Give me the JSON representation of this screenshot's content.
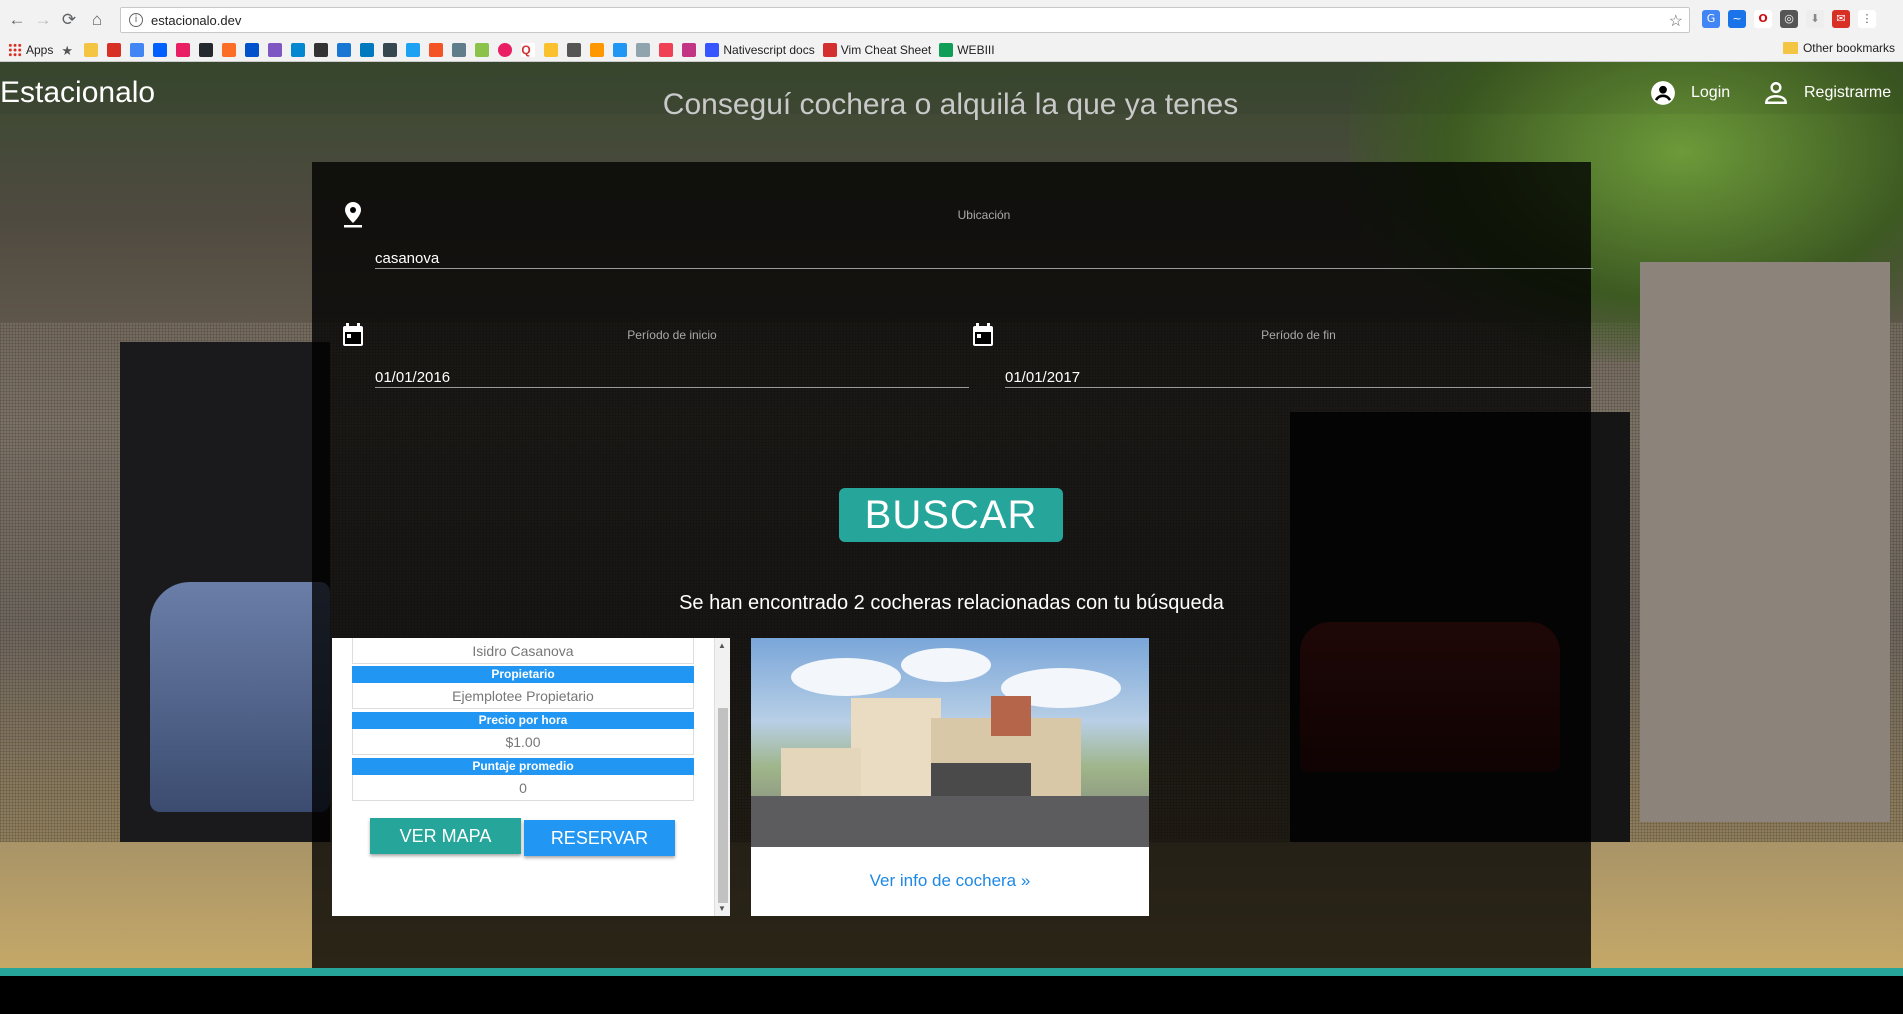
{
  "browser": {
    "url": "estacionalo.dev",
    "bookmarks": {
      "apps_label": "Apps",
      "nativescript_label": "Nativescript docs",
      "vim_label": "Vim Cheat Sheet",
      "webiii_label": "WEBIII",
      "other_label": "Other bookmarks"
    }
  },
  "header": {
    "brand": "Estacionalo",
    "tagline": "Conseguí cochera o alquilá la que ya tenes",
    "login_label": "Login",
    "register_label": "Registrarme"
  },
  "search": {
    "location": {
      "label": "Ubicación",
      "value": "casanova"
    },
    "start": {
      "label": "Período de inicio",
      "value": "01/01/2016"
    },
    "end": {
      "label": "Período de fin",
      "value": "01/01/2017"
    },
    "button_label": "BUSCAR"
  },
  "results": {
    "message": "Se han encontrado 2 cocheras relacionadas con tu búsqueda",
    "card1": {
      "address": "Isidro Casanova",
      "owner_label": "Propietario",
      "owner": "Ejemplotee Propietario",
      "price_label": "Precio por hora",
      "price": "$1.00",
      "rating_label": "Puntaje promedio",
      "rating": "0",
      "map_button": "VER MAPA",
      "reserve_button": "RESERVAR"
    },
    "card2": {
      "link_label": "Ver info de cochera »"
    }
  },
  "colors": {
    "teal": "#26a69a",
    "blue": "#2196f3",
    "link": "#1e88e5"
  }
}
